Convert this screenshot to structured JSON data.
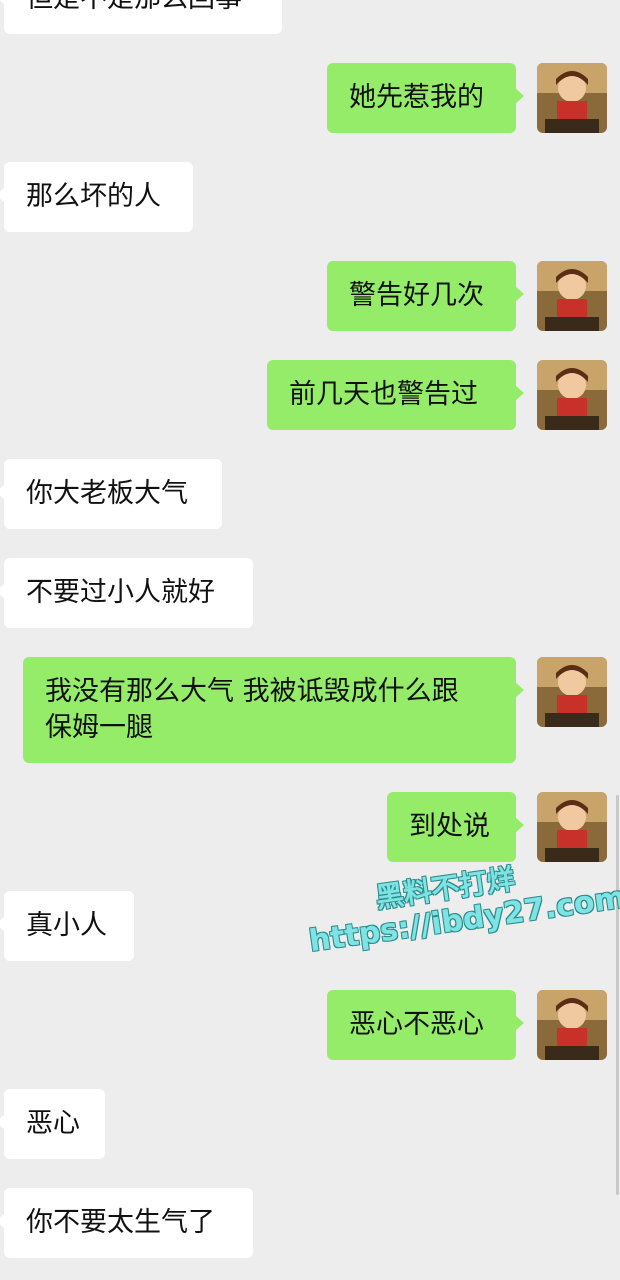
{
  "messages": [
    {
      "side": "in",
      "text": "但是不是那么回事"
    },
    {
      "side": "out",
      "text": "她先惹我的"
    },
    {
      "side": "in",
      "text": "那么坏的人"
    },
    {
      "side": "out",
      "text": "警告好几次"
    },
    {
      "side": "out",
      "text": "前几天也警告过"
    },
    {
      "side": "in",
      "text": "你大老板大气"
    },
    {
      "side": "in",
      "text": "不要过小人就好"
    },
    {
      "side": "out",
      "text": "我没有那么大气 我被诋毁成什么跟\n保姆一腿"
    },
    {
      "side": "out",
      "text": "到处说"
    },
    {
      "side": "in",
      "text": "真小人"
    },
    {
      "side": "out",
      "text": "恶心不恶心"
    },
    {
      "side": "in",
      "text": "恶心"
    },
    {
      "side": "in",
      "text": "你不要太生气了"
    }
  ],
  "watermark": {
    "line1": "黑料不打烊",
    "line2": "https://ibdy27.com"
  },
  "colors": {
    "background": "#ededed",
    "incoming_bubble": "#ffffff",
    "outgoing_bubble": "#95ec69",
    "watermark": "#7fe3e3"
  },
  "avatar": {
    "icon": "user-avatar-icon"
  }
}
